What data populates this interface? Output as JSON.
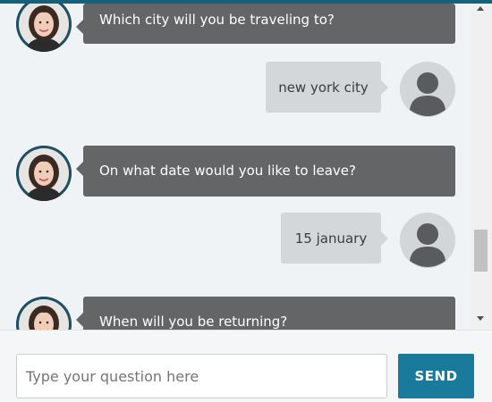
{
  "chat": {
    "messages": [
      {
        "sender": "bot",
        "text": "Which city will you be traveling to?"
      },
      {
        "sender": "user",
        "text": "new york city"
      },
      {
        "sender": "bot",
        "text": "On what date would you like to leave?"
      },
      {
        "sender": "user",
        "text": "15 january"
      },
      {
        "sender": "bot",
        "text": "When will you be returning?"
      }
    ],
    "bot_avatar_icon": "woman-portrait-icon",
    "user_avatar_icon": "person-silhouette-icon"
  },
  "composer": {
    "placeholder": "Type your question here",
    "value": "",
    "send_label": "SEND"
  },
  "colors": {
    "bot_bubble": "#636567",
    "user_bubble": "#d4d7d9",
    "send_button": "#1a7a9c",
    "accent_strip": "#17607c"
  }
}
